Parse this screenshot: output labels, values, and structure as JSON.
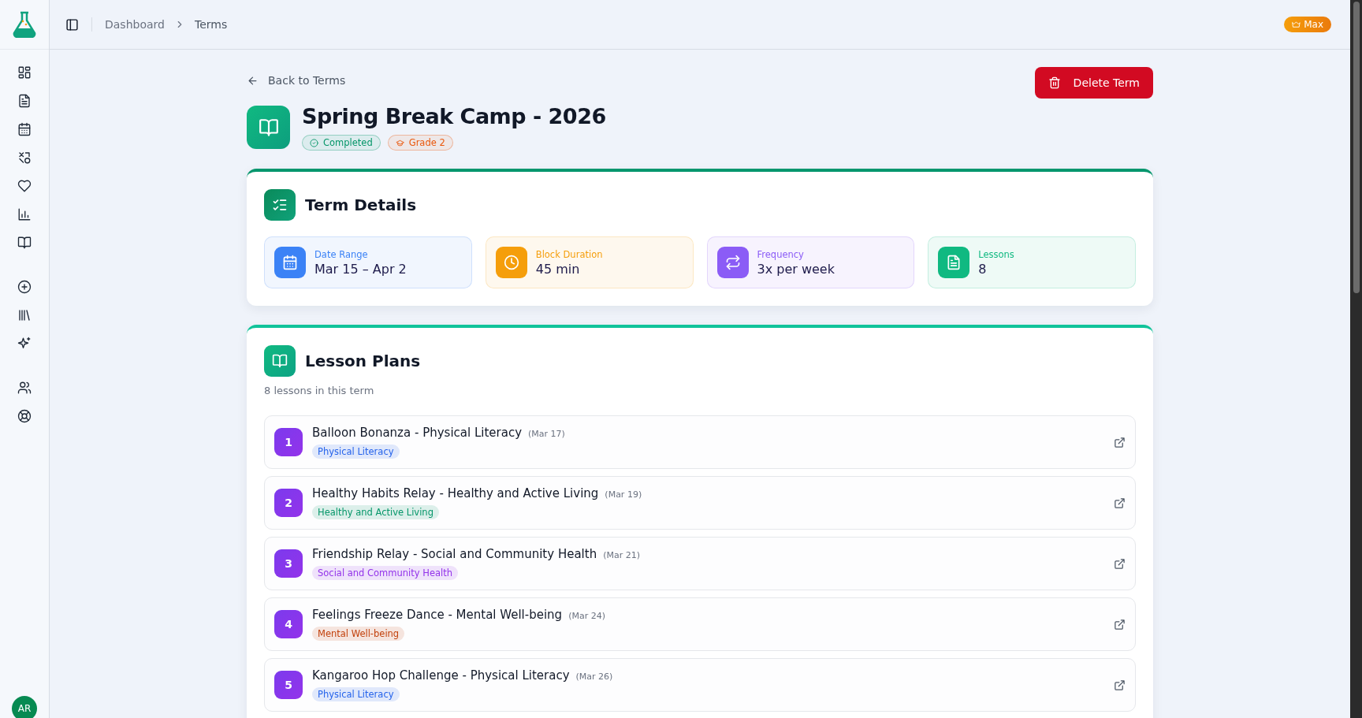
{
  "header": {
    "breadcrumbs": [
      {
        "label": "Dashboard",
        "current": false
      },
      {
        "label": "Terms",
        "current": true
      }
    ],
    "plan_badge": "Max"
  },
  "sidebar": {
    "items": [
      {
        "kind": "dashboard"
      },
      {
        "kind": "document"
      },
      {
        "kind": "calendar"
      },
      {
        "kind": "shapes"
      },
      {
        "kind": "heart"
      },
      {
        "kind": "chart"
      },
      {
        "kind": "book"
      },
      {
        "kind": "plus"
      },
      {
        "kind": "library"
      },
      {
        "kind": "sparkle"
      },
      {
        "kind": "users"
      },
      {
        "kind": "help"
      }
    ],
    "avatar": "AR"
  },
  "back_link": "Back to Terms",
  "delete_button": "Delete Term",
  "term": {
    "title": "Spring Break Camp - 2026",
    "badges": [
      {
        "kind": "status",
        "label": "Completed",
        "color": "#059669"
      },
      {
        "kind": "grade",
        "label": "Grade 2",
        "color": "#ea580c"
      }
    ]
  },
  "term_details": {
    "title": "Term Details",
    "stats": [
      {
        "kind": "date",
        "label": "Date Range",
        "value": "Mar 15 – Apr 2",
        "color": "#3b82f6"
      },
      {
        "kind": "duration",
        "label": "Block Duration",
        "value": "45 min",
        "color": "#f59e0b"
      },
      {
        "kind": "frequency",
        "label": "Frequency",
        "value": "3x per week",
        "color": "#8b5cf6"
      },
      {
        "kind": "count",
        "label": "Lessons",
        "value": "8",
        "color": "#10b981"
      }
    ]
  },
  "lesson_plans": {
    "title": "Lesson Plans",
    "subtitle": "8 lessons in this term",
    "lessons": [
      {
        "number": "1",
        "title": "Balloon Bonanza - Physical Literacy",
        "date": "(Mar 17)",
        "tag": "Physical Literacy",
        "color": "#2563eb"
      },
      {
        "number": "2",
        "title": "Healthy Habits Relay - Healthy and Active Living",
        "date": "(Mar 19)",
        "tag": "Healthy and Active Living",
        "color": "#059669"
      },
      {
        "number": "3",
        "title": "Friendship Relay - Social and Community Health",
        "date": "(Mar 21)",
        "tag": "Social and Community Health",
        "color": "#9333ea"
      },
      {
        "number": "4",
        "title": "Feelings Freeze Dance - Mental Well-being",
        "date": "(Mar 24)",
        "tag": "Mental Well-being",
        "color": "#c2410c"
      },
      {
        "number": "5",
        "title": "Kangaroo Hop Challenge - Physical Literacy",
        "date": "(Mar 26)",
        "tag": "Physical Literacy",
        "color": "#2563eb"
      }
    ]
  }
}
